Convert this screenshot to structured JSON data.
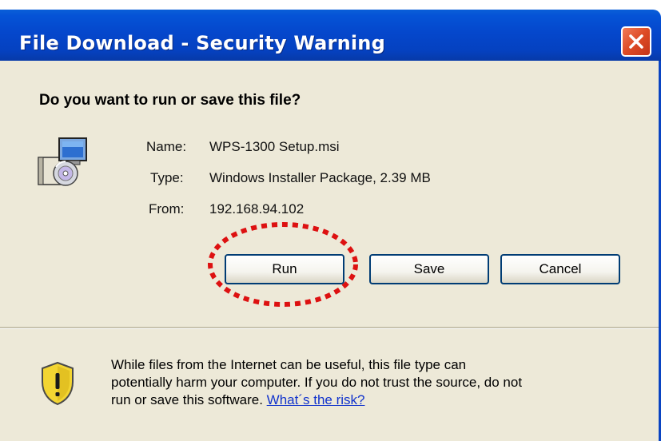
{
  "window": {
    "title": "File Download - Security Warning"
  },
  "dialog": {
    "question": "Do you want to run or save this file?",
    "fields": {
      "name_label": "Name:",
      "name_value": "WPS-1300 Setup.msi",
      "type_label": "Type:",
      "type_value": "Windows Installer Package, 2.39 MB",
      "from_label": "From:",
      "from_value": "192.168.94.102"
    },
    "buttons": {
      "run": "Run",
      "save": "Save",
      "cancel": "Cancel"
    },
    "warning": {
      "line1": "While files from the Internet can be useful, this file type can",
      "line2": "potentially harm your computer. If you do not trust the source, do not",
      "line3": "run or save this software.",
      "link": "What´s the risk?"
    }
  },
  "icons": {
    "close": "close-icon",
    "file": "installer-package-icon",
    "shield": "security-shield-icon"
  },
  "colors": {
    "titlebar": "#0547cc",
    "dialog_background": "#ede9d8",
    "close_button": "#dd4a25",
    "highlight_circle": "#dd1111",
    "link": "#1133cc"
  }
}
